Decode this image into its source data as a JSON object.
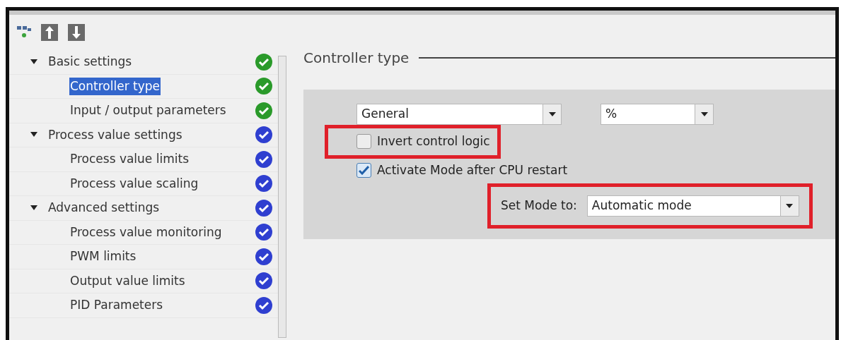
{
  "toolbar": [
    {
      "kind": "network"
    },
    {
      "kind": "up"
    },
    {
      "kind": "down"
    }
  ],
  "tree": [
    {
      "label": "Basic settings",
      "expanded": true,
      "selected": false,
      "color": "#2a9a2a",
      "children": [
        {
          "label": "Controller type",
          "selected": true,
          "color": "#2a9a2a"
        },
        {
          "label": "Input / output parameters",
          "selected": false,
          "color": "#2a9a2a"
        }
      ]
    },
    {
      "label": "Process value settings",
      "expanded": true,
      "selected": false,
      "color": "#2f3fd0",
      "children": [
        {
          "label": "Process value limits",
          "selected": false,
          "color": "#2f3fd0"
        },
        {
          "label": "Process value scaling",
          "selected": false,
          "color": "#2f3fd0"
        }
      ]
    },
    {
      "label": "Advanced settings",
      "expanded": true,
      "selected": false,
      "color": "#2f3fd0",
      "children": [
        {
          "label": "Process value monitoring",
          "selected": false,
          "color": "#2f3fd0"
        },
        {
          "label": "PWM limits",
          "selected": false,
          "color": "#2f3fd0"
        },
        {
          "label": "Output value limits",
          "selected": false,
          "color": "#2f3fd0"
        },
        {
          "label": "PID Parameters",
          "selected": false,
          "color": "#2f3fd0"
        }
      ]
    }
  ],
  "section": {
    "title": "Controller type",
    "dropdowns": [
      {
        "value": "General"
      },
      {
        "value": "%"
      }
    ],
    "checkboxes": [
      {
        "label": "Invert control logic",
        "checked": false,
        "highlighted": true
      },
      {
        "label": "Activate Mode after CPU restart",
        "checked": true,
        "highlighted": false
      }
    ],
    "mode": {
      "label": "Set Mode to:",
      "value": "Automatic mode",
      "highlighted": true
    }
  }
}
